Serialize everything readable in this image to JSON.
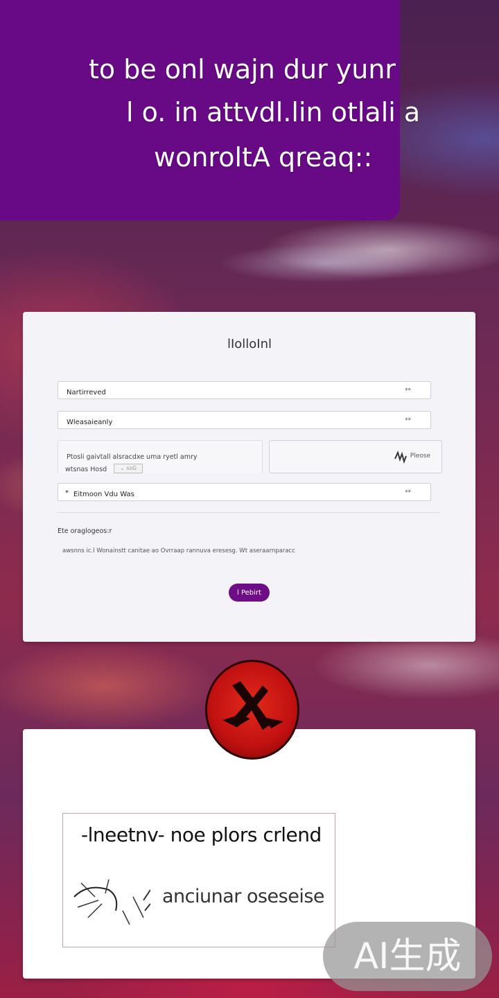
{
  "banner": {
    "line1": "to be onl wajn dur yunr",
    "line2": "l o. in attvdl.lin otlali a",
    "line3": "wonroltA qreaq::"
  },
  "form": {
    "title": "lIolloInl",
    "field1": {
      "label": "Nartirreved",
      "dots": "**"
    },
    "field2": {
      "label": "Wleasaieanly",
      "dots": "**"
    },
    "left_box": {
      "line1": "Ptosli gaivtall alsracdxe  uma ryetl amry",
      "line2": "wtsnas  Hosd",
      "chip": "⌄ ssG"
    },
    "right_box": {
      "icon": "signature-icon",
      "label": "Pleose"
    },
    "field3": {
      "label": "Eitmoon  Vdu Was",
      "dots": "**",
      "marker": "*"
    },
    "section_label": "Ete oraglogeos:r",
    "section_text": "awsnns  ic.l Wonainstt canitae ao  Ovrraap  rannuva eresesg.  Wt  aseraarnparacc",
    "submit_label": "l Pebirt"
  },
  "preview": {
    "line1": "-lneetnv- noe plors crlend",
    "line2": "anciunar oseseise"
  },
  "watermark": "AI生成",
  "colors": {
    "brand_purple": "#680a86",
    "button_purple": "#6e0d86",
    "badge_red": "#d01a12"
  }
}
